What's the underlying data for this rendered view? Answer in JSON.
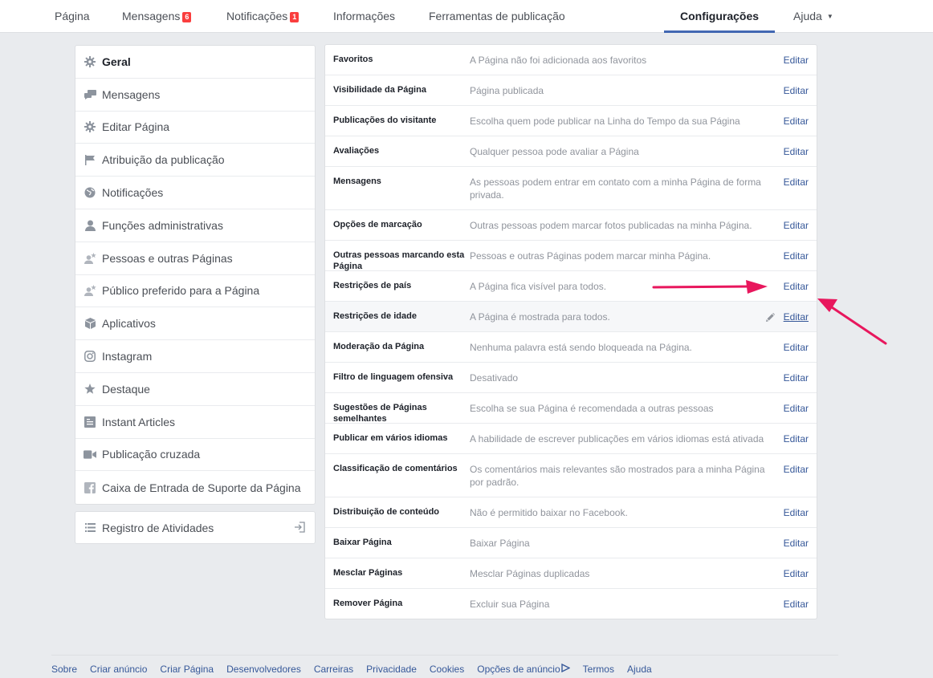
{
  "topnav": {
    "tabs": [
      {
        "label": "Página"
      },
      {
        "label": "Mensagens",
        "badge": "6"
      },
      {
        "label": "Notificações",
        "badge": "1"
      },
      {
        "label": "Informações"
      },
      {
        "label": "Ferramentas de publicação"
      },
      {
        "label": "Configurações",
        "active": true
      },
      {
        "label": "Ajuda"
      }
    ]
  },
  "sidebar": {
    "items": [
      {
        "label": "Geral",
        "icon": "gear-icon",
        "active": true
      },
      {
        "label": "Mensagens",
        "icon": "messages-icon"
      },
      {
        "label": "Editar Página",
        "icon": "gear-icon"
      },
      {
        "label": "Atribuição da publicação",
        "icon": "flag-icon"
      },
      {
        "label": "Notificações",
        "icon": "globe-icon"
      },
      {
        "label": "Funções administrativas",
        "icon": "person-icon"
      },
      {
        "label": "Pessoas e outras Páginas",
        "icon": "person-star-icon"
      },
      {
        "label": "Público preferido para a Página",
        "icon": "person-star-icon"
      },
      {
        "label": "Aplicativos",
        "icon": "cube-icon"
      },
      {
        "label": "Instagram",
        "icon": "instagram-icon"
      },
      {
        "label": "Destaque",
        "icon": "star-icon"
      },
      {
        "label": "Instant Articles",
        "icon": "article-icon"
      },
      {
        "label": "Publicação cruzada",
        "icon": "video-camera-icon"
      },
      {
        "label": "Caixa de Entrada de Suporte da Página",
        "icon": "facebook-icon"
      }
    ],
    "activity_log": {
      "label": "Registro de Atividades",
      "icon": "list-icon"
    }
  },
  "settings": {
    "edit_label": "Editar",
    "rows": [
      {
        "label": "Favoritos",
        "value": "A Página não foi adicionada aos favoritos"
      },
      {
        "label": "Visibilidade da Página",
        "value": "Página publicada"
      },
      {
        "label": "Publicações do visitante",
        "value": "Escolha quem pode publicar na Linha do Tempo da sua Página"
      },
      {
        "label": "Avaliações",
        "value": "Qualquer pessoa pode avaliar a Página"
      },
      {
        "label": "Mensagens",
        "value": "As pessoas podem entrar em contato com a minha Página de forma privada."
      },
      {
        "label": "Opções de marcação",
        "value": "Outras pessoas podem marcar fotos publicadas na minha Página."
      },
      {
        "label": "Outras pessoas marcando esta Página",
        "value": "Pessoas e outras Páginas podem marcar minha Página."
      },
      {
        "label": "Restrições de país",
        "value": "A Página fica visível para todos."
      },
      {
        "label": "Restrições de idade",
        "value": "A Página é mostrada para todos.",
        "hover": true
      },
      {
        "label": "Moderação da Página",
        "value": "Nenhuma palavra está sendo bloqueada na Página."
      },
      {
        "label": "Filtro de linguagem ofensiva",
        "value": "Desativado"
      },
      {
        "label": "Sugestões de Páginas semelhantes",
        "value": "Escolha se sua Página é recomendada a outras pessoas"
      },
      {
        "label": "Publicar em vários idiomas",
        "value": "A habilidade de escrever publicações em vários idiomas está ativada"
      },
      {
        "label": "Classificação de comentários",
        "value": "Os comentários mais relevantes são mostrados para a minha Página por padrão."
      },
      {
        "label": "Distribuição de conteúdo",
        "value": "Não é permitido baixar no Facebook."
      },
      {
        "label": "Baixar Página",
        "value": "Baixar Página"
      },
      {
        "label": "Mesclar Páginas",
        "value": "Mesclar Páginas duplicadas"
      },
      {
        "label": "Remover Página",
        "value": "Excluir sua Página"
      }
    ]
  },
  "footer": {
    "links": [
      "Sobre",
      "Criar anúncio",
      "Criar Página",
      "Desenvolvedores",
      "Carreiras",
      "Privacidade",
      "Cookies",
      "Opções de anúncio",
      "Termos",
      "Ajuda"
    ]
  },
  "colors": {
    "accent": "#4267b2",
    "link": "#365899",
    "badge": "#fa3e3e",
    "annotation_arrow": "#e8175d"
  }
}
